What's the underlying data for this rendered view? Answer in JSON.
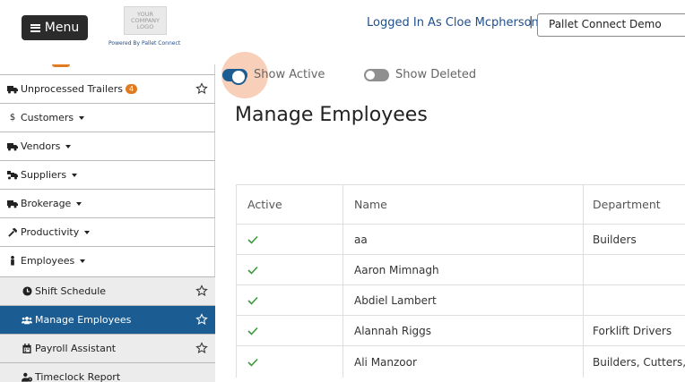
{
  "header": {
    "menu_label": "Menu",
    "logo_line1": "YOUR",
    "logo_line2": "COMPANY",
    "logo_line3": "LOGO",
    "powered_by": "Powered By Pallet Connect",
    "logged_in_text": "Logged In As Cloe Mcpherson",
    "separator": "|",
    "company_selected": "Pallet Connect Demo"
  },
  "sidebar": {
    "items": [
      {
        "label": "Unprocessed Trailers",
        "icon": "truck-icon",
        "badge": "4",
        "starred": true
      },
      {
        "label": "Customers",
        "icon": "dollar-icon",
        "dropdown": true
      },
      {
        "label": "Vendors",
        "icon": "truck-icon",
        "dropdown": true
      },
      {
        "label": "Suppliers",
        "icon": "truck-loading-icon",
        "dropdown": true
      },
      {
        "label": "Brokerage",
        "icon": "truck-icon",
        "dropdown": true
      },
      {
        "label": "Productivity",
        "icon": "hammer-icon",
        "dropdown": true
      },
      {
        "label": "Employees",
        "icon": "person-icon",
        "dropdown": true
      },
      {
        "label": "Shift Schedule",
        "icon": "clock-icon",
        "sub": true,
        "starred": true
      },
      {
        "label": "Manage Employees",
        "icon": "users-icon",
        "sub": true,
        "active": true,
        "starred": true
      },
      {
        "label": "Payroll Assistant",
        "icon": "calendar-icon",
        "sub": true,
        "starred": true
      },
      {
        "label": "Timeclock Report",
        "icon": "user-clock-icon",
        "sub": true
      }
    ]
  },
  "filters": {
    "show_active_label": "Show Active",
    "show_active_on": true,
    "show_deleted_label": "Show Deleted",
    "show_deleted_on": false
  },
  "page_title": "Manage Employees",
  "table": {
    "columns": [
      "Active",
      "Name",
      "Department"
    ],
    "rows": [
      {
        "active": true,
        "name": "aa",
        "department": "Builders"
      },
      {
        "active": true,
        "name": "Aaron Mimnagh",
        "department": ""
      },
      {
        "active": true,
        "name": "Abdiel Lambert",
        "department": ""
      },
      {
        "active": true,
        "name": "Alannah Riggs",
        "department": "Forklift Drivers"
      },
      {
        "active": true,
        "name": "Ali Manzoor",
        "department": "Builders, Cutters, I"
      }
    ]
  },
  "colors": {
    "primary": "#1b5d93",
    "accent": "#e07b22",
    "check": "#3a9a3a"
  }
}
